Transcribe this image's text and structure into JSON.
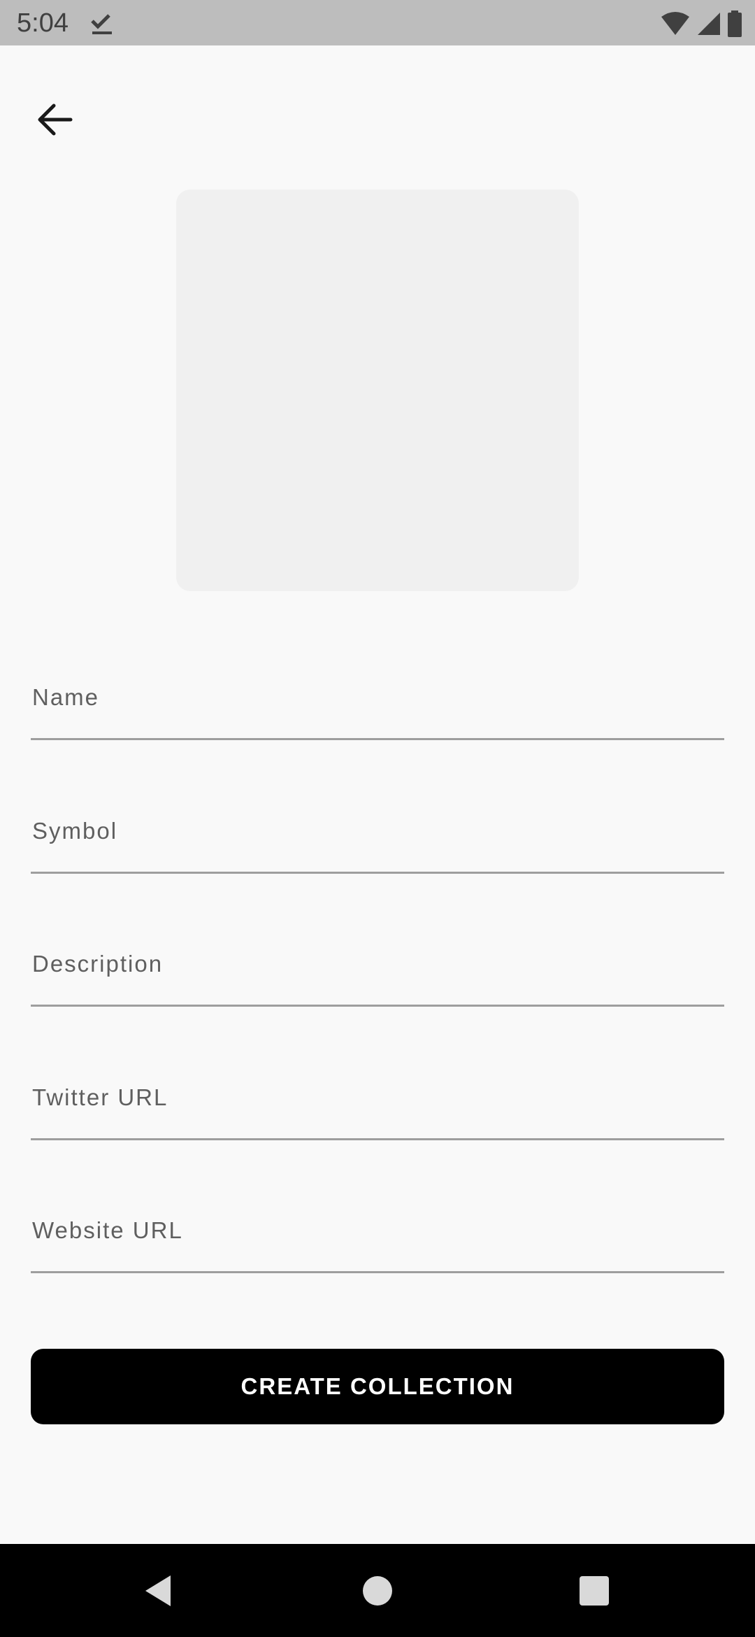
{
  "status_bar": {
    "time": "5:04",
    "icons": [
      "download-done-icon",
      "wifi-icon",
      "signal-icon",
      "battery-icon"
    ]
  },
  "header": {
    "back_icon": "arrow-back-icon"
  },
  "form": {
    "fields": [
      {
        "placeholder": "Name",
        "value": ""
      },
      {
        "placeholder": "Symbol",
        "value": ""
      },
      {
        "placeholder": "Description",
        "value": ""
      },
      {
        "placeholder": "Twitter URL",
        "value": ""
      },
      {
        "placeholder": "Website URL",
        "value": ""
      }
    ],
    "submit_label": "CREATE COLLECTION"
  },
  "nav_bar": {
    "buttons": [
      "back-triangle-icon",
      "home-circle-icon",
      "recents-square-icon"
    ]
  },
  "colors": {
    "status_bar_bg": "#bdbdbd",
    "page_bg": "#f9f9f9",
    "placeholder_box": "#f0f0f0",
    "button_bg": "#000000",
    "button_text": "#ffffff"
  }
}
